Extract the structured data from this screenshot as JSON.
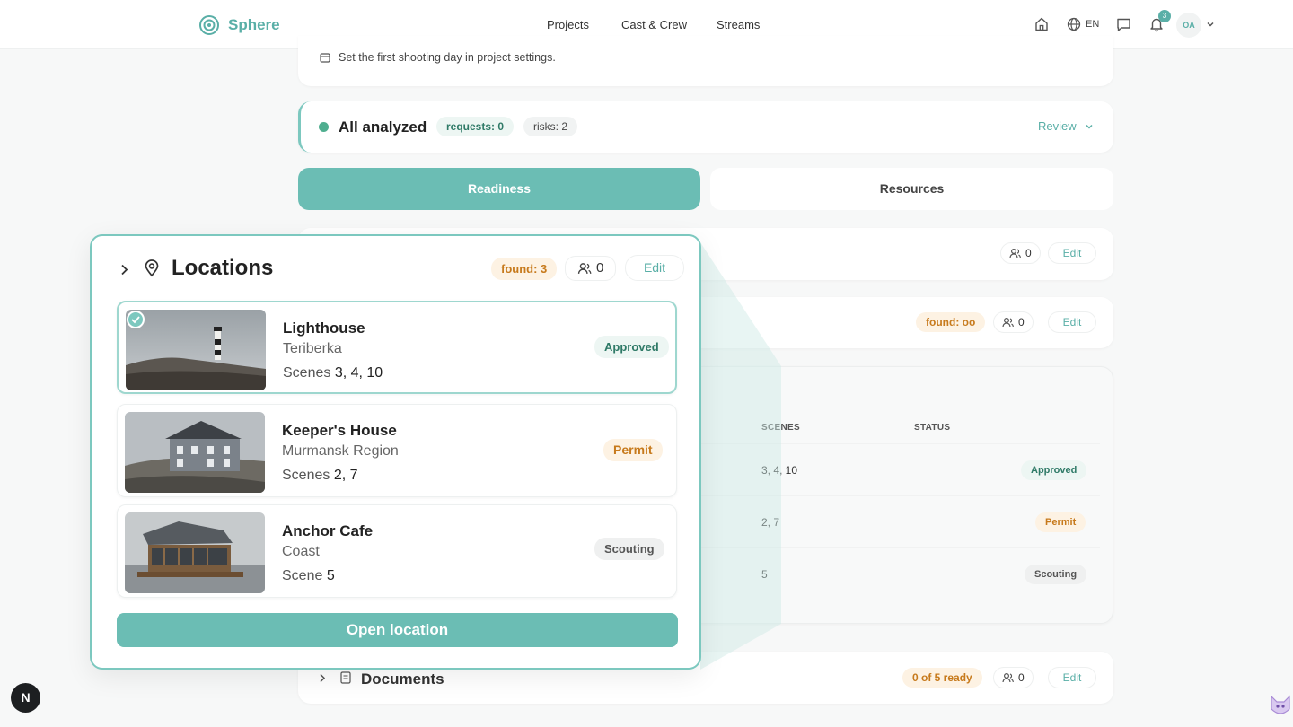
{
  "app": {
    "name": "Sphere",
    "accent": "#5aafa7"
  },
  "nav": {
    "projects": "Projects",
    "cast_crew": "Cast & Crew",
    "streams": "Streams"
  },
  "topbar": {
    "lang": "EN",
    "notifications_count": "3",
    "avatar_initials": "OA"
  },
  "hint": {
    "text": "Set the first shooting day in project settings."
  },
  "analysis": {
    "title": "All analyzed",
    "requests": "requests: 0",
    "risks": "risks: 2",
    "review": "Review"
  },
  "tabs": {
    "readiness": "Readiness",
    "resources": "Resources"
  },
  "rows": {
    "row1": {
      "people": "0",
      "edit": "Edit"
    },
    "row2": {
      "found": "found: oo",
      "people": "0",
      "edit": "Edit"
    }
  },
  "table": {
    "headers": {
      "scenes": "SCENES",
      "status": "STATUS"
    },
    "rows": [
      {
        "scenes": "3, 4, 10",
        "status": "Approved"
      },
      {
        "scenes": "2, 7",
        "status": "Permit"
      },
      {
        "scenes": "5",
        "status": "Scouting"
      }
    ]
  },
  "documents": {
    "title": "Documents",
    "ready": "0 of 5 ready",
    "people": "0",
    "edit": "Edit"
  },
  "popup": {
    "title": "Locations",
    "found": "found: 3",
    "people": "0",
    "edit": "Edit",
    "locations": [
      {
        "name": "Lighthouse",
        "region": "Teriberka",
        "scenes_label": "Scenes",
        "scenes": "3, 4, 10",
        "status": "Approved"
      },
      {
        "name": "Keeper's House",
        "region": "Murmansk Region",
        "scenes_label": "Scenes",
        "scenes": "2, 7",
        "status": "Permit"
      },
      {
        "name": "Anchor Cafe",
        "region": "Coast",
        "scenes_label": "Scene",
        "scenes": "5",
        "status": "Scouting"
      }
    ],
    "open_button": "Open location"
  },
  "corner": {
    "badge": "N"
  }
}
